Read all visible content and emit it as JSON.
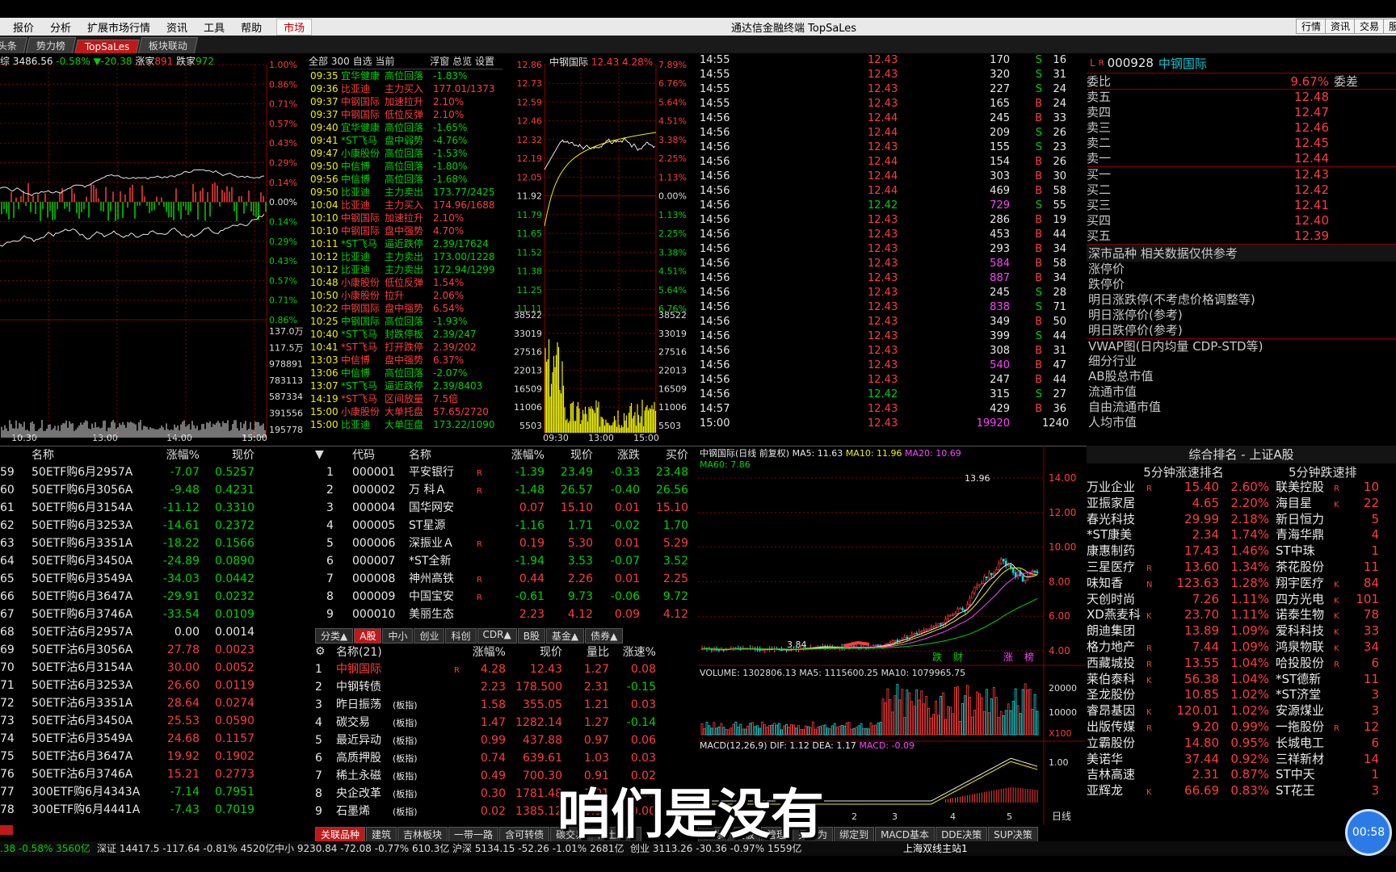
{
  "menu": {
    "items": [
      "报价",
      "分析",
      "扩展市场行情",
      "资讯",
      "工具",
      "帮助"
    ],
    "market": "市场",
    "title": "通达信金融终端 TopSaLes",
    "right": [
      "行情",
      "资讯",
      "交易",
      "服"
    ]
  },
  "tabs": [
    "头条",
    "势力榜",
    "TopSaLes",
    "板块联动"
  ],
  "index_header": {
    "name": "综",
    "value": "3486.56",
    "pct": "-0.58%",
    "chg": "▼-20.38",
    "up_label": "涨家",
    "up": "891",
    "down_label": "跌家",
    "down": "972"
  },
  "index_pct_axis": [
    "1.00%",
    "0.86%",
    "0.71%",
    "0.57%",
    "0.43%",
    "0.29%",
    "0.14%",
    "0.00%",
    "0.14%",
    "0.29%",
    "0.43%",
    "0.57%",
    "0.71%",
    "0.86%"
  ],
  "index_vol_axis": [
    "137.0万",
    "117.5万",
    "978891",
    "783113",
    "587334",
    "391556",
    "195778"
  ],
  "index_time_axis": [
    "10:30",
    "13:00",
    "14:00",
    "15:00"
  ],
  "radar_header": [
    "全部",
    "300",
    "自选",
    "当前",
    "浮窗",
    "总览",
    "设置"
  ],
  "radar": [
    [
      "09:35",
      "宜华健康",
      "高位回落",
      "-1.83%",
      "g"
    ],
    [
      "09:36",
      "比亚迪",
      "主力买入",
      "177.01/1373",
      "r"
    ],
    [
      "09:37",
      "中钢国际",
      "加速拉升",
      "2.10%",
      "r"
    ],
    [
      "09:37",
      "中钢国际",
      "低位反弹",
      "2.10%",
      "r"
    ],
    [
      "09:40",
      "宜华健康",
      "高位回落",
      "-1.65%",
      "g"
    ],
    [
      "09:41",
      "*ST飞马",
      "盘中弱势",
      "-4.76%",
      "g"
    ],
    [
      "09:47",
      "小康股份",
      "高位回落",
      "-1.53%",
      "g"
    ],
    [
      "09:50",
      "中信博",
      "高位回落",
      "-1.80%",
      "g"
    ],
    [
      "09:56",
      "中信博",
      "高位回落",
      "-1.68%",
      "g"
    ],
    [
      "09:50",
      "比亚迪",
      "主力卖出",
      "173.77/2425",
      "g"
    ],
    [
      "10:04",
      "比亚迪",
      "主力买入",
      "174.96/1688",
      "r"
    ],
    [
      "10:10",
      "中钢国际",
      "加速拉升",
      "2.10%",
      "r"
    ],
    [
      "10:10",
      "中钢国际",
      "盘中强势",
      "4.70%",
      "r"
    ],
    [
      "10:11",
      "*ST飞马",
      "逼近跌停",
      "2.39/17624",
      "g"
    ],
    [
      "10:12",
      "比亚迪",
      "主力卖出",
      "173.00/1228",
      "g"
    ],
    [
      "10:12",
      "比亚迪",
      "主力卖出",
      "172.94/1299",
      "g"
    ],
    [
      "10:48",
      "小康股份",
      "低位反弹",
      "1.54%",
      "r"
    ],
    [
      "10:50",
      "小康股份",
      "拉升",
      "2.06%",
      "r"
    ],
    [
      "10:22",
      "中钢国际",
      "盘中强势",
      "6.54%",
      "r"
    ],
    [
      "10:25",
      "中钢国际",
      "高位回落",
      "-1.93%",
      "g"
    ],
    [
      "10:40",
      "*ST飞马",
      "封跌停板",
      "2.39/247",
      "g"
    ],
    [
      "10:41",
      "*ST飞马",
      "打开跌停",
      "2.39/202",
      "r"
    ],
    [
      "13:03",
      "中信博",
      "盘中强势",
      "6.37%",
      "r"
    ],
    [
      "13:06",
      "中信博",
      "高位回落",
      "-2.07%",
      "g"
    ],
    [
      "13:07",
      "*ST飞马",
      "逼近跌停",
      "2.39/8403",
      "g"
    ],
    [
      "14:19",
      "*ST飞马",
      "区间放量",
      "7.5倍",
      "r"
    ],
    [
      "15:00",
      "小康股份",
      "大单托盘",
      "57.65/2720",
      "r"
    ],
    [
      "15:00",
      "比亚迪",
      "大单压盘",
      "173.22/1090",
      "g"
    ]
  ],
  "stock_min": {
    "name": "中钢国际",
    "price": "12.43",
    "pct": "4.28%",
    "left_axis": [
      "12.86",
      "12.73",
      "12.59",
      "12.46",
      "12.32",
      "12.19",
      "12.05",
      "11.92",
      "11.79",
      "11.65",
      "11.52",
      "11.38",
      "11.25",
      "11.11",
      "38522",
      "33019",
      "27516",
      "22013",
      "16509",
      "11006",
      "5503"
    ],
    "right_axis": [
      "7.89%",
      "6.76%",
      "5.64%",
      "4.51%",
      "3.38%",
      "2.25%",
      "1.13%",
      "0.00%",
      "1.13%",
      "2.25%",
      "3.38%",
      "4.51%",
      "5.64%",
      "6.76%",
      "38522",
      "33019",
      "27516",
      "22013",
      "16509",
      "11006",
      "5503"
    ],
    "time_axis": [
      "09:30",
      "13:00",
      "15:00"
    ]
  },
  "ticks": [
    [
      "14:55",
      "12.43",
      "170",
      "S",
      "16"
    ],
    [
      "14:55",
      "12.43",
      "320",
      "S",
      "31"
    ],
    [
      "14:55",
      "12.43",
      "227",
      "S",
      "24"
    ],
    [
      "14:55",
      "12.43",
      "165",
      "B",
      "24"
    ],
    [
      "14:56",
      "12.44",
      "245",
      "B",
      "33"
    ],
    [
      "14:56",
      "12.44",
      "209",
      "S",
      "26"
    ],
    [
      "14:56",
      "12.43",
      "155",
      "S",
      "23"
    ],
    [
      "14:56",
      "12.44",
      "154",
      "B",
      "26"
    ],
    [
      "14:56",
      "12.44",
      "303",
      "B",
      "30"
    ],
    [
      "14:56",
      "12.44",
      "469",
      "B",
      "58"
    ],
    [
      "14:56",
      "12.42",
      "729",
      "S",
      "55"
    ],
    [
      "14:56",
      "12.43",
      "286",
      "B",
      "19"
    ],
    [
      "14:56",
      "12.43",
      "453",
      "B",
      "44"
    ],
    [
      "14:56",
      "12.43",
      "293",
      "B",
      "34"
    ],
    [
      "14:56",
      "12.43",
      "584",
      "B",
      "58"
    ],
    [
      "14:56",
      "12.43",
      "887",
      "B",
      "34"
    ],
    [
      "14:56",
      "12.43",
      "245",
      "S",
      "28"
    ],
    [
      "14:56",
      "12.43",
      "838",
      "S",
      "71"
    ],
    [
      "14:56",
      "12.43",
      "349",
      "B",
      "50"
    ],
    [
      "14:56",
      "12.43",
      "399",
      "S",
      "44"
    ],
    [
      "14:56",
      "12.43",
      "308",
      "B",
      "31"
    ],
    [
      "14:56",
      "12.43",
      "540",
      "B",
      "47"
    ],
    [
      "14:56",
      "12.43",
      "247",
      "B",
      "44"
    ],
    [
      "14:56",
      "12.42",
      "315",
      "S",
      "27"
    ],
    [
      "14:57",
      "12.43",
      "429",
      "B",
      "36"
    ],
    [
      "15:00",
      "12.43",
      "19920",
      "",
      "1240"
    ]
  ],
  "quote": {
    "code": "000928",
    "name": "中钢国际",
    "wb_label": "委比",
    "wb": "9.67%",
    "wc_label": "委差",
    "asks": [
      [
        "卖五",
        "12.48"
      ],
      [
        "卖四",
        "12.47"
      ],
      [
        "卖三",
        "12.46"
      ],
      [
        "卖二",
        "12.45"
      ],
      [
        "卖一",
        "12.44"
      ]
    ],
    "bids": [
      [
        "买一",
        "12.43"
      ],
      [
        "买二",
        "12.42"
      ],
      [
        "买三",
        "12.41"
      ],
      [
        "买四",
        "12.40"
      ],
      [
        "买五",
        "12.39"
      ]
    ],
    "info_title": "深市品种  相关数据仅供参考",
    "info": [
      "涨停价",
      "跌停价",
      "明日涨跌停(不考虑价格调整等)",
      "明日涨停价(参考)",
      "明日跌停价(参考)",
      "VWAP图(日内均量 CDP-STD等)",
      "细分行业",
      "AB股总市值",
      "流通市值",
      "自由流通市值",
      "人均市值"
    ]
  },
  "etf_header": [
    "名称",
    "涨幅%",
    "现价"
  ],
  "etf": [
    [
      "59",
      "50ETF购6月2957A",
      "-7.07",
      "0.5257",
      "g"
    ],
    [
      "60",
      "50ETF购6月3056A",
      "-9.48",
      "0.4231",
      "g"
    ],
    [
      "61",
      "50ETF购6月3154A",
      "-11.12",
      "0.3310",
      "g"
    ],
    [
      "62",
      "50ETF购6月3253A",
      "-14.61",
      "0.2372",
      "g"
    ],
    [
      "63",
      "50ETF购6月3351A",
      "-18.22",
      "0.1566",
      "g"
    ],
    [
      "64",
      "50ETF购6月3450A",
      "-24.89",
      "0.0890",
      "g"
    ],
    [
      "65",
      "50ETF购6月3549A",
      "-34.03",
      "0.0442",
      "g"
    ],
    [
      "66",
      "50ETF购6月3647A",
      "-29.91",
      "0.0232",
      "g"
    ],
    [
      "67",
      "50ETF购6月3746A",
      "-33.54",
      "0.0109",
      "g"
    ],
    [
      "68",
      "50ETF沽6月2957A",
      "0.00",
      "0.0014",
      "w"
    ],
    [
      "69",
      "50ETF沽6月3056A",
      "27.78",
      "0.0023",
      "r"
    ],
    [
      "70",
      "50ETF沽6月3154A",
      "30.00",
      "0.0052",
      "r"
    ],
    [
      "71",
      "50ETF沽6月3253A",
      "26.60",
      "0.0119",
      "r"
    ],
    [
      "72",
      "50ETF沽6月3351A",
      "28.64",
      "0.0274",
      "r"
    ],
    [
      "73",
      "50ETF沽6月3450A",
      "25.53",
      "0.0590",
      "r"
    ],
    [
      "74",
      "50ETF沽6月3549A",
      "24.68",
      "0.1157",
      "r"
    ],
    [
      "75",
      "50ETF沽6月3647A",
      "19.92",
      "0.1902",
      "r"
    ],
    [
      "76",
      "50ETF沽6月3746A",
      "15.21",
      "0.2773",
      "r"
    ],
    [
      "77",
      "300ETF购6月4343A",
      "-7.14",
      "0.7951",
      "g"
    ],
    [
      "78",
      "300ETF购6月4441A",
      "-7.43",
      "0.7019",
      "g"
    ]
  ],
  "stock_list_header": [
    "代码",
    "名称",
    "涨幅%",
    "现价",
    "涨跌",
    "买价"
  ],
  "stock_list": [
    [
      "1",
      "000001",
      "平安银行",
      "R",
      "-1.39",
      "23.49",
      "-0.33",
      "23.48",
      "g"
    ],
    [
      "2",
      "000002",
      "万 科Ａ",
      "R",
      "-1.48",
      "26.57",
      "-0.40",
      "26.56",
      "g"
    ],
    [
      "3",
      "000004",
      "国华网安",
      "",
      "0.07",
      "15.10",
      "0.01",
      "15.10",
      "r"
    ],
    [
      "4",
      "000005",
      "ST星源",
      "",
      "-1.16",
      "1.71",
      "-0.02",
      "1.70",
      "g"
    ],
    [
      "5",
      "000006",
      "深振业Ａ",
      "R",
      "0.19",
      "5.30",
      "0.01",
      "5.29",
      "r"
    ],
    [
      "6",
      "000007",
      "*ST全新",
      "",
      "-1.94",
      "3.53",
      "-0.07",
      "3.52",
      "g"
    ],
    [
      "7",
      "000008",
      "神州高铁",
      "R",
      "0.44",
      "2.26",
      "0.01",
      "2.25",
      "r"
    ],
    [
      "8",
      "000009",
      "中国宝安",
      "R",
      "-0.61",
      "9.73",
      "-0.06",
      "9.72",
      "g"
    ],
    [
      "9",
      "000010",
      "美丽生态",
      "",
      "2.23",
      "4.12",
      "0.09",
      "4.12",
      "r"
    ]
  ],
  "stock_list_tabs": [
    "分类▲",
    "A股",
    "中小",
    "创业",
    "科创",
    "CDR▲",
    "B股",
    "基金▲",
    "债券▲"
  ],
  "related_header": [
    "名称(21)",
    "涨幅%",
    "现价",
    "量比",
    "涨速%"
  ],
  "related": [
    [
      "1",
      "中钢国际",
      "",
      "R",
      "4.28",
      "12.43",
      "1.27",
      "0.08"
    ],
    [
      "2",
      "中钢转债",
      "",
      "",
      "2.23",
      "178.500",
      "2.31",
      "-0.15"
    ],
    [
      "3",
      "昨日振荡",
      "(板指)",
      "",
      "1.58",
      "355.05",
      "1.21",
      "0.03"
    ],
    [
      "4",
      "碳交易",
      "(板指)",
      "",
      "1.47",
      "1282.14",
      "1.27",
      "-0.14"
    ],
    [
      "5",
      "最近异动",
      "(板指)",
      "",
      "0.99",
      "437.88",
      "0.97",
      "0.06"
    ],
    [
      "6",
      "高质押股",
      "(板指)",
      "",
      "0.74",
      "639.61",
      "1.03",
      "0.03"
    ],
    [
      "7",
      "稀土永磁",
      "(板指)",
      "",
      "0.49",
      "700.30",
      "0.91",
      "0.02"
    ],
    [
      "8",
      "央企改革",
      "(板指)",
      "",
      "0.30",
      "1781.48",
      "1.01",
      "0.05"
    ],
    [
      "9",
      "石墨烯",
      "(板指)",
      "",
      "0.02",
      "1385.12",
      "0.98",
      "0.00"
    ]
  ],
  "related_tabs": [
    "关联品种",
    "建筑",
    "吉林板块",
    "一带一路",
    "含可转债",
    "碳交易",
    "稀土永磁"
  ],
  "kline": {
    "title": "中钢国际(日线 前复权)",
    "ma5": "MA5: 11.63",
    "ma10": "MA10: 11.96",
    "ma20": "MA20: 10.69",
    "ma60": "MA60: 7.86",
    "axis": [
      "14.00",
      "12.00",
      "10.00",
      "8.00",
      "6.00",
      "4.00"
    ],
    "high": "13.96",
    "low": "3.84",
    "marks": [
      "跌",
      "财",
      "涨",
      "榜"
    ],
    "vol_title": "VOLUME: 1302806.13  MA5: 1115600.25  MA10: 1079965.75",
    "vol_axis": [
      "20000",
      "10000",
      "X100"
    ],
    "macd_title": "MACD(12,26,9)  DIF: 1.12  DEA: 1.17",
    "macd_val": "MACD: -0.09",
    "macd_axis": [
      "1.00"
    ],
    "months": [
      "2",
      "3",
      "4",
      "5"
    ],
    "period": "日线"
  },
  "kline_tabs": [
    "指标",
    "模板",
    "管理",
    "另存为",
    "绑定到",
    "MACD基本",
    "DDE决策",
    "SUP决策"
  ],
  "rank": {
    "title": "综合排名 - 上证A股",
    "left_title": "5分钟涨速排名",
    "right_title": "5分钟跌速排",
    "rows": [
      [
        "万业企业",
        "R",
        "15.40",
        "2.60%",
        "联美控股",
        "R",
        "10"
      ],
      [
        "亚振家居",
        "",
        "4.65",
        "2.20%",
        "海目星",
        "K",
        "22"
      ],
      [
        "春光科技",
        "",
        "29.99",
        "2.18%",
        "新日恒力",
        "",
        "5"
      ],
      [
        "*ST康美",
        "",
        "2.34",
        "1.74%",
        "青海华鼎",
        "",
        "4"
      ],
      [
        "康惠制药",
        "",
        "17.43",
        "1.46%",
        "ST中珠",
        "",
        "1"
      ],
      [
        "三星医疗",
        "R",
        "13.60",
        "1.34%",
        "茶花股份",
        "",
        "11"
      ],
      [
        "味知香",
        "N",
        "123.63",
        "1.28%",
        "翔宇医疗",
        "K",
        "84"
      ],
      [
        "天创时尚",
        "",
        "7.26",
        "1.11%",
        "四方光电",
        "K",
        "101"
      ],
      [
        "XD燕麦科",
        "K",
        "23.70",
        "1.11%",
        "诺泰生物",
        "K",
        "78"
      ],
      [
        "朗迪集团",
        "",
        "13.89",
        "1.09%",
        "爱科科技",
        "K",
        "33"
      ],
      [
        "格力地产",
        "R",
        "7.44",
        "1.09%",
        "鸿泉物联",
        "K",
        "34"
      ],
      [
        "西藏城投",
        "R",
        "13.55",
        "1.04%",
        "哈投股份",
        "R",
        "6"
      ],
      [
        "莱伯泰科",
        "K",
        "56.38",
        "1.04%",
        "*ST德新",
        "",
        "11"
      ],
      [
        "圣龙股份",
        "",
        "10.85",
        "1.02%",
        "*ST济堂",
        "",
        "3"
      ],
      [
        "睿昂基因",
        "K",
        "120.01",
        "1.02%",
        "安源煤业",
        "",
        "3"
      ],
      [
        "出版传媒",
        "R",
        "9.20",
        "0.99%",
        "一拖股份",
        "R",
        "12"
      ],
      [
        "立霸股份",
        "",
        "14.80",
        "0.95%",
        "长城电工",
        "",
        "6"
      ],
      [
        "美诺华",
        "",
        "37.44",
        "0.92%",
        "三祥新材",
        "",
        "14"
      ],
      [
        "吉林高速",
        "",
        "2.31",
        "0.87%",
        "ST中天",
        "",
        "1"
      ],
      [
        "亚辉龙",
        "K",
        "66.69",
        "0.83%",
        "ST花王",
        "",
        "3"
      ]
    ]
  },
  "bottom": {
    "a": ".38  -0.58% 3560亿",
    "b": "深证 14417.5 -117.64 -0.81% 4520亿",
    "c": "中小 9230.84 -72.08 -0.77% 610.3亿",
    "d": "沪深 5134.15 -52.26 -1.01% 2681亿",
    "e": "创业 3113.26 -30.36 -0.97% 1559亿",
    "f": "上海双线主站1"
  },
  "caption": "咱们是没有",
  "timer": "00:58",
  "colors": {
    "up": "#ff3c3c",
    "down": "#00d200",
    "grid": "#8a0000",
    "accent": "#c01818"
  }
}
